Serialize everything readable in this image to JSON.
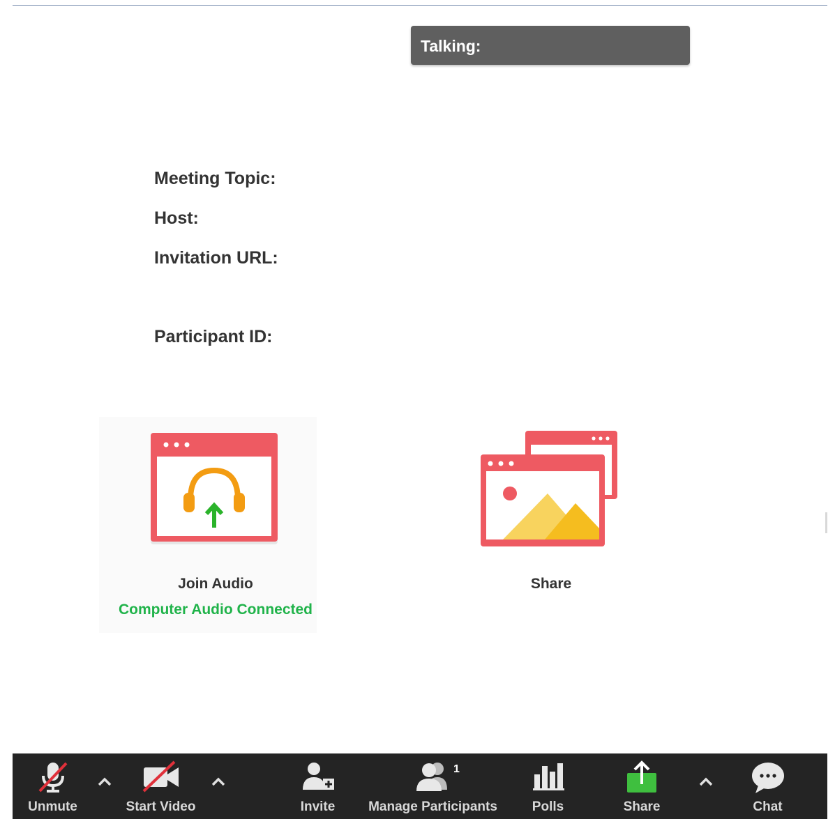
{
  "talking": {
    "label": "Talking:"
  },
  "meeting_info": {
    "topic_label": "Meeting Topic:",
    "host_label": "Host:",
    "url_label": "Invitation URL:",
    "participant_label": "Participant ID:"
  },
  "tiles": {
    "join_audio": {
      "label": "Join Audio",
      "status": "Computer Audio Connected"
    },
    "share": {
      "label": "Share"
    }
  },
  "toolbar": {
    "unmute": "Unmute",
    "start_video": "Start Video",
    "invite": "Invite",
    "manage_participants": "Manage Participants",
    "participant_count": "1",
    "polls": "Polls",
    "share": "Share",
    "chat": "Chat"
  },
  "colors": {
    "window_red": "#ee5a62",
    "audio_orange": "#f39c12",
    "arrow_green": "#2ab32a",
    "status_green": "#20b34a",
    "toolbar_bg": "#242424",
    "share_green": "#3fbf3f",
    "mute_slash": "#e0303a"
  }
}
